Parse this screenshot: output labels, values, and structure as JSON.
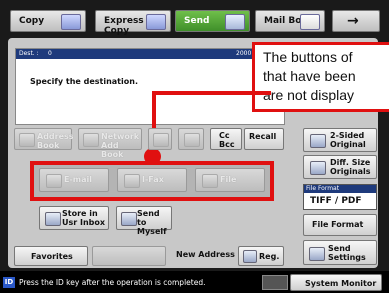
{
  "tabs": {
    "copy": "Copy",
    "express_copy": "Express Copy",
    "send": "Send",
    "mail_box": "Mail Box",
    "next": "→"
  },
  "screen": {
    "dest_label": "Dest. :",
    "dest_count": "0",
    "date": "2000 0",
    "prompt": "Specify the destination."
  },
  "callout": {
    "line1": "The buttons of",
    "line2": "that have been",
    "line3": "are not display"
  },
  "address_row": {
    "address_book": "Address Book",
    "network_address_book": "Network Add Book",
    "cc_bcc": "Cc Bcc",
    "recall": "Recall"
  },
  "send_types": {
    "email": "E-mail",
    "ifax": "I-Fax",
    "file": "File"
  },
  "actions": {
    "store_user_inbox": "Store in Usr Inbox",
    "send_to_myself": "Send to Myself"
  },
  "bottom_row": {
    "favorites": "Favorites",
    "new_address": "New Address",
    "reg": "Reg."
  },
  "side": {
    "two_sided": "2-Sided Original",
    "diff_size": "Diff. Size Originals",
    "file_format_label": "File Format",
    "file_format_value": "TIFF / PDF",
    "file_format_button": "File Format",
    "send_settings": "Send Settings"
  },
  "status": {
    "id_badge": "ID",
    "message": "Press the ID key after the operation is completed.",
    "system_monitor": "System Monitor"
  },
  "colors": {
    "callout_border": "#e01010",
    "send_tab": "#4f9f35",
    "screen_header": "#1e3a7c"
  }
}
